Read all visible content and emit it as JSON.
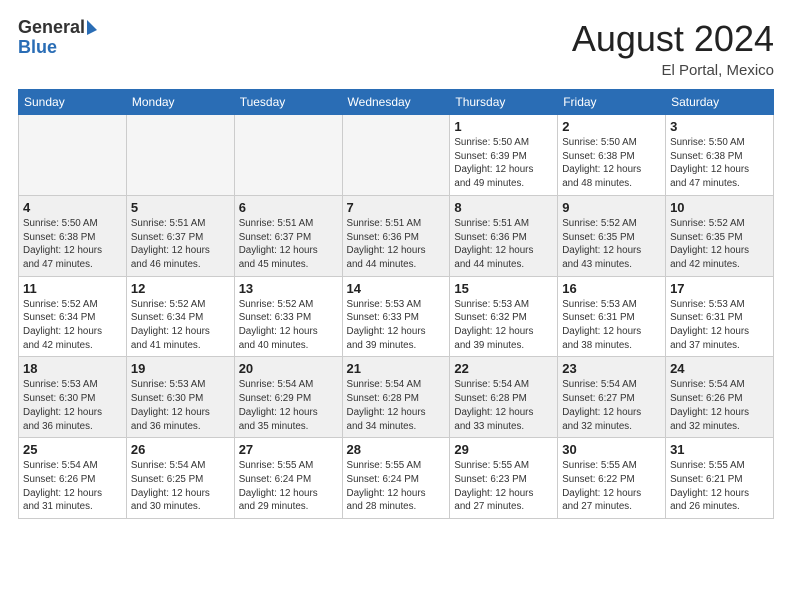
{
  "header": {
    "logo_general": "General",
    "logo_blue": "Blue",
    "month_title": "August 2024",
    "location": "El Portal, Mexico"
  },
  "days_of_week": [
    "Sunday",
    "Monday",
    "Tuesday",
    "Wednesday",
    "Thursday",
    "Friday",
    "Saturday"
  ],
  "weeks": [
    [
      {
        "day": null,
        "info": null
      },
      {
        "day": null,
        "info": null
      },
      {
        "day": null,
        "info": null
      },
      {
        "day": null,
        "info": null
      },
      {
        "day": "1",
        "info": "Sunrise: 5:50 AM\nSunset: 6:39 PM\nDaylight: 12 hours\nand 49 minutes."
      },
      {
        "day": "2",
        "info": "Sunrise: 5:50 AM\nSunset: 6:38 PM\nDaylight: 12 hours\nand 48 minutes."
      },
      {
        "day": "3",
        "info": "Sunrise: 5:50 AM\nSunset: 6:38 PM\nDaylight: 12 hours\nand 47 minutes."
      }
    ],
    [
      {
        "day": "4",
        "info": "Sunrise: 5:50 AM\nSunset: 6:38 PM\nDaylight: 12 hours\nand 47 minutes."
      },
      {
        "day": "5",
        "info": "Sunrise: 5:51 AM\nSunset: 6:37 PM\nDaylight: 12 hours\nand 46 minutes."
      },
      {
        "day": "6",
        "info": "Sunrise: 5:51 AM\nSunset: 6:37 PM\nDaylight: 12 hours\nand 45 minutes."
      },
      {
        "day": "7",
        "info": "Sunrise: 5:51 AM\nSunset: 6:36 PM\nDaylight: 12 hours\nand 44 minutes."
      },
      {
        "day": "8",
        "info": "Sunrise: 5:51 AM\nSunset: 6:36 PM\nDaylight: 12 hours\nand 44 minutes."
      },
      {
        "day": "9",
        "info": "Sunrise: 5:52 AM\nSunset: 6:35 PM\nDaylight: 12 hours\nand 43 minutes."
      },
      {
        "day": "10",
        "info": "Sunrise: 5:52 AM\nSunset: 6:35 PM\nDaylight: 12 hours\nand 42 minutes."
      }
    ],
    [
      {
        "day": "11",
        "info": "Sunrise: 5:52 AM\nSunset: 6:34 PM\nDaylight: 12 hours\nand 42 minutes."
      },
      {
        "day": "12",
        "info": "Sunrise: 5:52 AM\nSunset: 6:34 PM\nDaylight: 12 hours\nand 41 minutes."
      },
      {
        "day": "13",
        "info": "Sunrise: 5:52 AM\nSunset: 6:33 PM\nDaylight: 12 hours\nand 40 minutes."
      },
      {
        "day": "14",
        "info": "Sunrise: 5:53 AM\nSunset: 6:33 PM\nDaylight: 12 hours\nand 39 minutes."
      },
      {
        "day": "15",
        "info": "Sunrise: 5:53 AM\nSunset: 6:32 PM\nDaylight: 12 hours\nand 39 minutes."
      },
      {
        "day": "16",
        "info": "Sunrise: 5:53 AM\nSunset: 6:31 PM\nDaylight: 12 hours\nand 38 minutes."
      },
      {
        "day": "17",
        "info": "Sunrise: 5:53 AM\nSunset: 6:31 PM\nDaylight: 12 hours\nand 37 minutes."
      }
    ],
    [
      {
        "day": "18",
        "info": "Sunrise: 5:53 AM\nSunset: 6:30 PM\nDaylight: 12 hours\nand 36 minutes."
      },
      {
        "day": "19",
        "info": "Sunrise: 5:53 AM\nSunset: 6:30 PM\nDaylight: 12 hours\nand 36 minutes."
      },
      {
        "day": "20",
        "info": "Sunrise: 5:54 AM\nSunset: 6:29 PM\nDaylight: 12 hours\nand 35 minutes."
      },
      {
        "day": "21",
        "info": "Sunrise: 5:54 AM\nSunset: 6:28 PM\nDaylight: 12 hours\nand 34 minutes."
      },
      {
        "day": "22",
        "info": "Sunrise: 5:54 AM\nSunset: 6:28 PM\nDaylight: 12 hours\nand 33 minutes."
      },
      {
        "day": "23",
        "info": "Sunrise: 5:54 AM\nSunset: 6:27 PM\nDaylight: 12 hours\nand 32 minutes."
      },
      {
        "day": "24",
        "info": "Sunrise: 5:54 AM\nSunset: 6:26 PM\nDaylight: 12 hours\nand 32 minutes."
      }
    ],
    [
      {
        "day": "25",
        "info": "Sunrise: 5:54 AM\nSunset: 6:26 PM\nDaylight: 12 hours\nand 31 minutes."
      },
      {
        "day": "26",
        "info": "Sunrise: 5:54 AM\nSunset: 6:25 PM\nDaylight: 12 hours\nand 30 minutes."
      },
      {
        "day": "27",
        "info": "Sunrise: 5:55 AM\nSunset: 6:24 PM\nDaylight: 12 hours\nand 29 minutes."
      },
      {
        "day": "28",
        "info": "Sunrise: 5:55 AM\nSunset: 6:24 PM\nDaylight: 12 hours\nand 28 minutes."
      },
      {
        "day": "29",
        "info": "Sunrise: 5:55 AM\nSunset: 6:23 PM\nDaylight: 12 hours\nand 27 minutes."
      },
      {
        "day": "30",
        "info": "Sunrise: 5:55 AM\nSunset: 6:22 PM\nDaylight: 12 hours\nand 27 minutes."
      },
      {
        "day": "31",
        "info": "Sunrise: 5:55 AM\nSunset: 6:21 PM\nDaylight: 12 hours\nand 26 minutes."
      }
    ]
  ]
}
